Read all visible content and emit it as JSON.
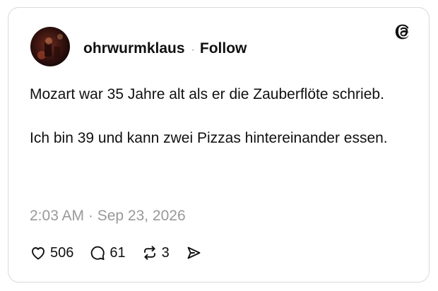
{
  "post": {
    "username": "ohrwurmklaus",
    "separator": "·",
    "follow_label": "Follow",
    "paragraphs": [
      "Mozart war 35 Jahre alt als er die Zauberflöte schrieb.",
      "Ich bin 39 und kann zwei Pizzas hintereinander essen."
    ],
    "timestamp": "2:03 AM · Sep 23, 2026"
  },
  "actions": {
    "likes": "506",
    "comments": "61",
    "reposts": "3"
  },
  "icons": {
    "brand": "threads-logo-icon",
    "like": "heart-icon",
    "comment": "speech-bubble-icon",
    "repost": "repost-arrows-icon",
    "share": "send-paper-plane-icon"
  },
  "colors": {
    "text": "#101010",
    "muted": "#999999",
    "border": "#d9d9d9"
  }
}
